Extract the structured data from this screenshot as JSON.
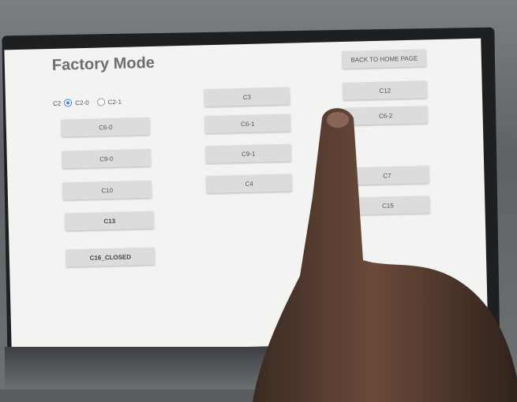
{
  "title": "Factory Mode",
  "back_button": "BACK TO HOME PAGE",
  "radio": {
    "label": "C2",
    "options": [
      "C2-0",
      "C2-1"
    ],
    "selected": "C2-0"
  },
  "col1": [
    "C6-0",
    "C9-0",
    "C10",
    "C13",
    "C16_CLOSED"
  ],
  "col2": [
    "C3",
    "C6-1",
    "C9-1",
    "C4"
  ],
  "col3": [
    "C12",
    "C6-2",
    "C7",
    "C15"
  ]
}
